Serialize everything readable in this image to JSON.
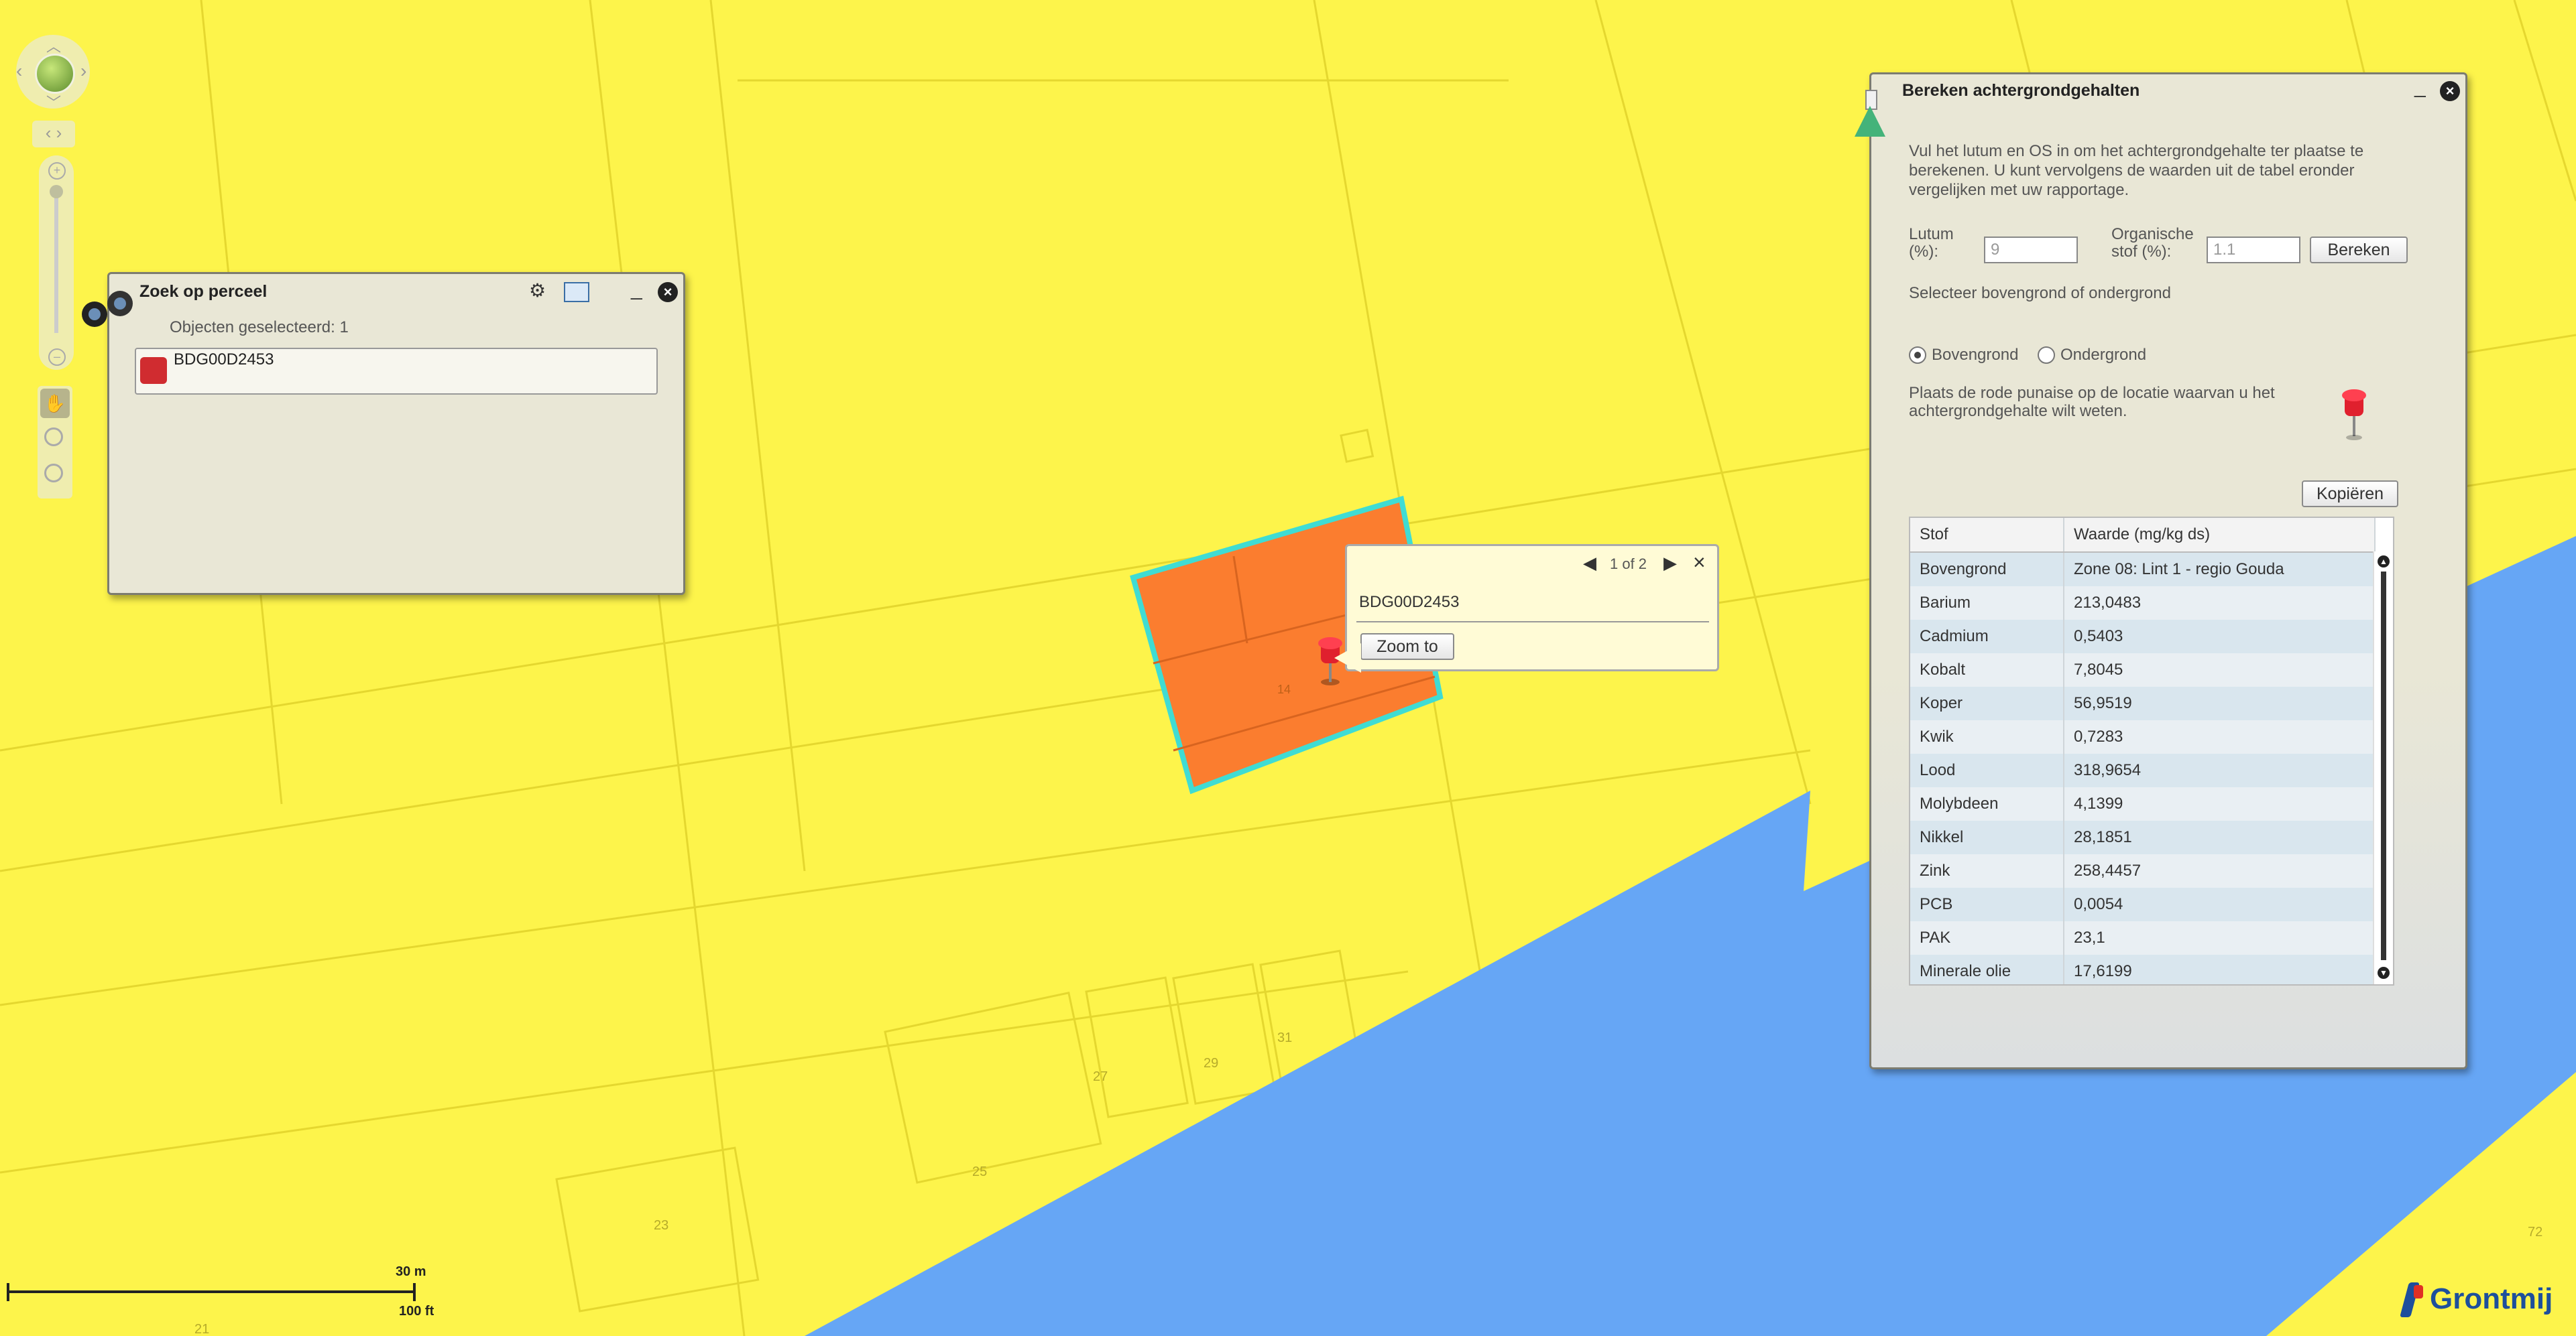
{
  "nav": {
    "pan_label": "✋"
  },
  "search_panel": {
    "title": "Zoek op perceel",
    "selected_text": "Objecten geselecteerd: 1",
    "results": [
      "BDG00D2453"
    ]
  },
  "popup": {
    "pager": "1 of 2",
    "parcel_id": "BDG00D2453",
    "zoom_button": "Zoom to"
  },
  "calc_panel": {
    "title": "Bereken achtergrondgehalten",
    "intro": [
      "Vul het lutum en OS in om het achtergrondgehalte ter plaatse te",
      "berekenen. U kunt vervolgens de waarden uit de tabel eronder",
      "vergelijken met uw rapportage."
    ],
    "lutum_label": [
      "Lutum",
      "(%):"
    ],
    "lutum_value": "9",
    "os_label": [
      "Organische",
      "stof (%):"
    ],
    "os_value": "1.1",
    "calc_button": "Bereken",
    "select_text": "Selecteer bovengrond of ondergrond",
    "radio_top": "Bovengrond",
    "radio_bottom": "Ondergrond",
    "selected": "Bovengrond",
    "pin_text": [
      "Plaats de rode punaise op de locatie waarvan u het",
      "achtergrondgehalte wilt weten."
    ],
    "copy_button": "Kopiëren",
    "table": {
      "headers": [
        "Stof",
        "Waarde (mg/kg ds)"
      ],
      "rows": [
        [
          "Bovengrond",
          "Zone 08: Lint 1 - regio Gouda"
        ],
        [
          "Barium",
          "213,0483"
        ],
        [
          "Cadmium",
          "0,5403"
        ],
        [
          "Kobalt",
          "7,8045"
        ],
        [
          "Koper",
          "56,9519"
        ],
        [
          "Kwik",
          "0,7283"
        ],
        [
          "Lood",
          "318,9654"
        ],
        [
          "Molybdeen",
          "4,1399"
        ],
        [
          "Nikkel",
          "28,1851"
        ],
        [
          "Zink",
          "258,4457"
        ],
        [
          "PCB",
          "0,0054"
        ],
        [
          "PAK",
          "23,1"
        ],
        [
          "Minerale olie",
          "17,6199"
        ]
      ]
    }
  },
  "map": {
    "parcel_number": "14",
    "house_numbers": [
      "27",
      "29",
      "31",
      "25",
      "23",
      "21",
      "72"
    ],
    "scale_m": "30 m",
    "scale_ft": "100 ft"
  },
  "logo": {
    "text": "Grontmij"
  },
  "colors": {
    "map_yellow": "#fdf44b",
    "water": "#66a6f5",
    "parcel": "#fb7d2f",
    "parcel_outline": "#3fdcd3",
    "panel_bg": "#e9e7d6"
  }
}
